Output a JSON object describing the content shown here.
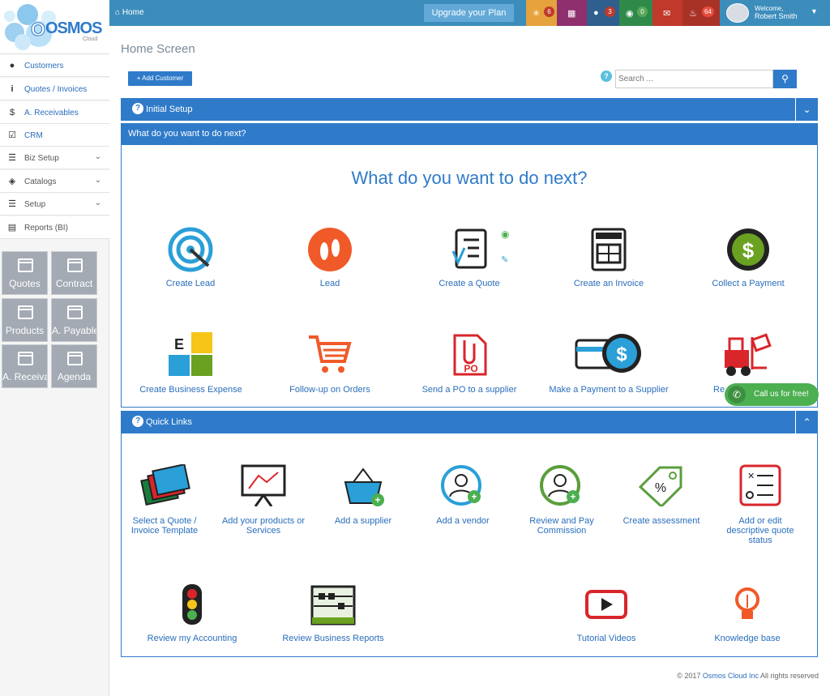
{
  "brand": {
    "name": "OSMOS",
    "sub": "Cloud"
  },
  "topbar": {
    "home": "Home",
    "upgrade": "Upgrade your Plan",
    "welcome": "Welcome,",
    "user": "Robert Smith",
    "badges": {
      "ideas": "6",
      "alerts": "3",
      "messages": "0",
      "notifications": "64"
    }
  },
  "sidebar": {
    "items": [
      {
        "label": "Customers",
        "icon": "user-icon"
      },
      {
        "label": "Quotes / Invoices",
        "icon": "info-icon"
      },
      {
        "label": "A. Receivables",
        "icon": "dollar-icon"
      },
      {
        "label": "CRM",
        "icon": "check-icon"
      },
      {
        "label": "Biz Setup",
        "icon": "list-icon"
      },
      {
        "label": "Catalogs",
        "icon": "palette-icon"
      },
      {
        "label": "Setup",
        "icon": "list-icon"
      },
      {
        "label": "Reports (BI)",
        "icon": "chart-icon"
      }
    ],
    "tiles": [
      "Quotes",
      "Contract",
      "Products",
      "A. Payable",
      "A. Receivab",
      "Agenda"
    ]
  },
  "page": {
    "title": "Home Screen",
    "add_customer": "+ Add Customer",
    "search_placeholder": "Search ..."
  },
  "initial": {
    "title": "Initial Setup"
  },
  "next": {
    "bar": "What do you want to do next?",
    "heading": "What do you want to do next?",
    "actions": [
      "Create Lead",
      "Lead",
      "Create a Quote",
      "Create an Invoice",
      "Collect a Payment",
      "Create Business Expense",
      "Follow-up on Orders",
      "Send a PO to a supplier",
      "Make a Payment to a Supplier",
      "Re"
    ]
  },
  "call": "Call us for free!",
  "quick": {
    "title": "Quick Links",
    "links": [
      "Select a Quote / Invoice Template",
      "Add your products or Services",
      "Add a supplier",
      "Add a vendor",
      "Review and Pay Commission",
      "Create assessment",
      "Add or edit descriptive quote status",
      "Review my Accounting",
      "Review Business Reports",
      "Tutorial Videos",
      "Knowledge base"
    ]
  },
  "footer": {
    "prefix": "© 2017",
    "company": "Osmos Cloud Inc",
    "suffix": "All rights reserved"
  },
  "colors": {
    "primary": "#2f7bc9",
    "topbar": "#3c8dbc",
    "green": "#4caf50",
    "orange": "#f05a28"
  }
}
